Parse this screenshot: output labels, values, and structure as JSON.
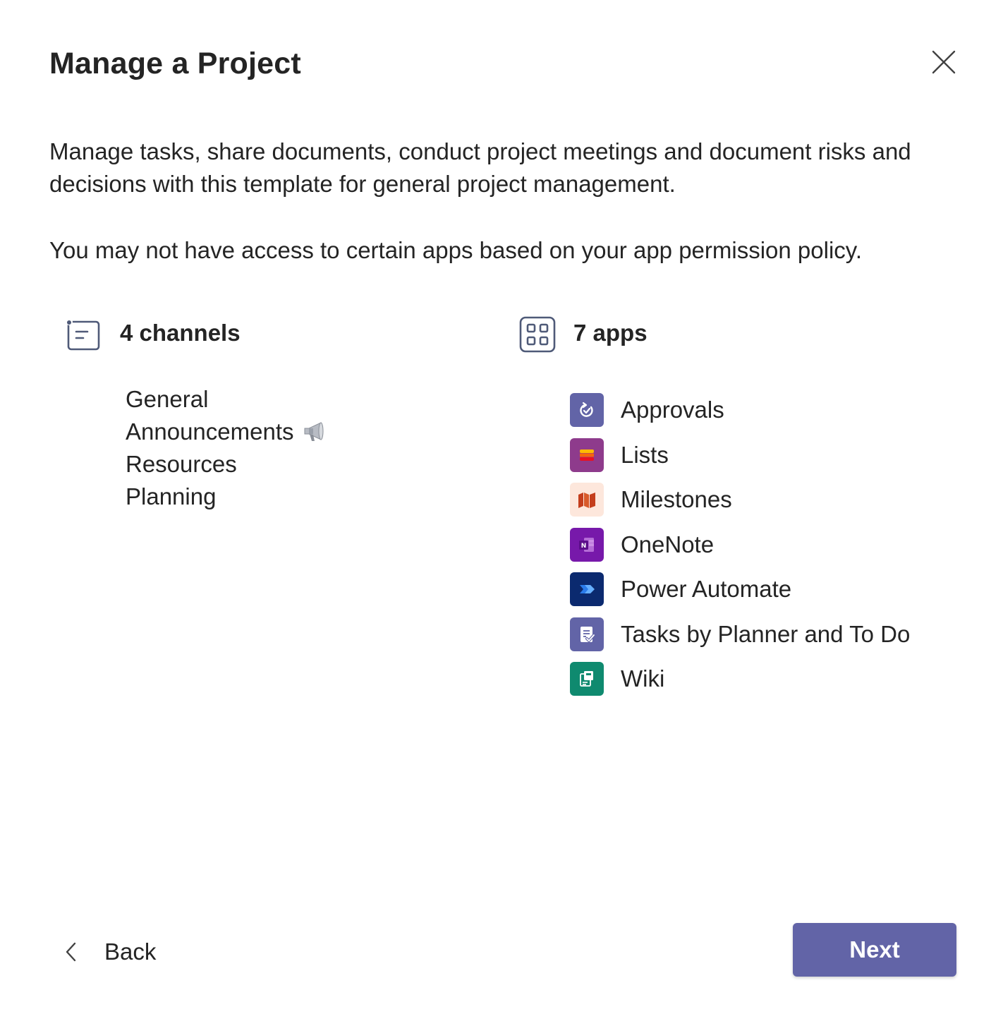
{
  "dialog": {
    "title": "Manage a Project",
    "close_icon": "close-icon",
    "description": "Manage tasks, share documents, conduct project meetings and document risks and decisions with this template for general project management.",
    "permission_note": "You may not have access to certain apps based on your app permission policy."
  },
  "channels": {
    "heading": "4 channels",
    "icon": "channel-list-icon",
    "items": [
      {
        "label": "General"
      },
      {
        "label": "Announcements",
        "icon": "megaphone-icon"
      },
      {
        "label": "Resources"
      },
      {
        "label": "Planning"
      }
    ]
  },
  "apps": {
    "heading": "7 apps",
    "icon": "apps-grid-icon",
    "items": [
      {
        "label": "Approvals",
        "icon": "approvals-icon",
        "color": "#6264a7"
      },
      {
        "label": "Lists",
        "icon": "lists-icon",
        "color": "#8e3b8c"
      },
      {
        "label": "Milestones",
        "icon": "milestones-icon",
        "color": "#fde7dc"
      },
      {
        "label": "OneNote",
        "icon": "onenote-icon",
        "color": "#7719aa"
      },
      {
        "label": "Power Automate",
        "icon": "power-automate-icon",
        "color": "#0b2a6f"
      },
      {
        "label": "Tasks by Planner and To Do",
        "icon": "tasks-icon",
        "color": "#6264a7"
      },
      {
        "label": "Wiki",
        "icon": "wiki-icon",
        "color": "#0f8a6f"
      }
    ]
  },
  "footer": {
    "back_label": "Back",
    "next_label": "Next",
    "accent_color": "#6264a7"
  }
}
